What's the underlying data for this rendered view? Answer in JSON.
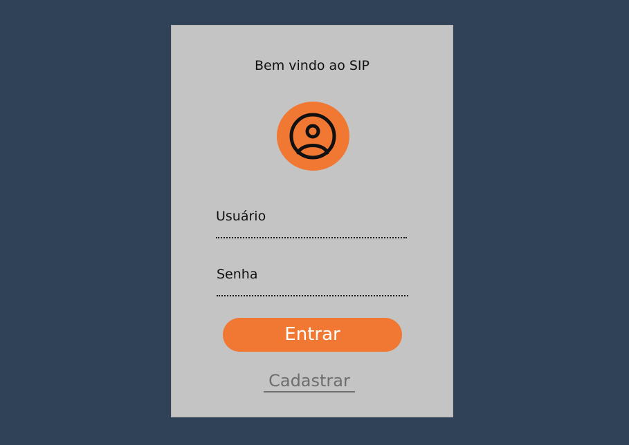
{
  "login": {
    "title": "Bem vindo ao SIP",
    "avatar_icon": "user-circle-icon",
    "username_label": "Usuário",
    "username_value": "",
    "password_label": "Senha",
    "password_value": "",
    "enter_label": "Entrar",
    "register_label": "Cadastrar"
  },
  "colors": {
    "background": "#2f4257",
    "card": "#c4c4c4",
    "accent": "#f07833",
    "link": "#6e6e6e"
  }
}
